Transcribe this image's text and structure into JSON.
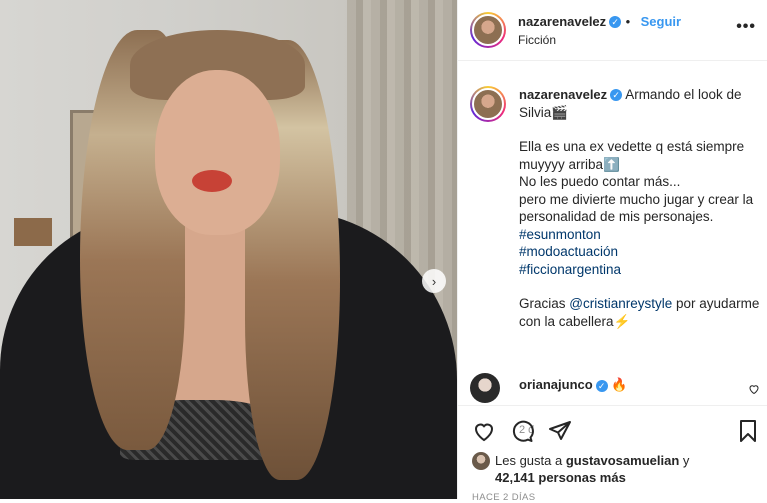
{
  "header": {
    "username": "nazarenavelez",
    "follow_label": "Seguir",
    "location": "Ficción",
    "more_label": "•••"
  },
  "caption": {
    "username": "nazarenavelez",
    "line1": "Armando el look de Silvia🎬",
    "line2": "Ella es una ex vedette q está siempre muyyyy arriba⬆️",
    "line3": "No les puedo contar más...",
    "line4": "pero me divierte mucho jugar y crear la personalidad de mis personajes.",
    "hashtags": [
      "#esunmonton",
      "#modoactuación",
      "#ficcionargentina"
    ],
    "thanks_prefix": "Gracias",
    "mention": "@cristianreystyle",
    "thanks_suffix": "por ayudarme con la cabellera⚡",
    "time": "2 d"
  },
  "comment": {
    "username": "orianajunco",
    "text": "🔥"
  },
  "likes": {
    "prefix": "Les gusta a",
    "user": "gustavosamuelian",
    "and": "y",
    "count": "42,141 personas más"
  },
  "posted": "HACE 2 DÍAS",
  "icons": {
    "next": "chevron-right-icon",
    "heart": "heart-icon",
    "comment": "comment-icon",
    "share": "share-icon",
    "save": "bookmark-icon"
  },
  "colors": {
    "link": "#00376b",
    "follow": "#3897f0",
    "verified": "#3897f0"
  }
}
